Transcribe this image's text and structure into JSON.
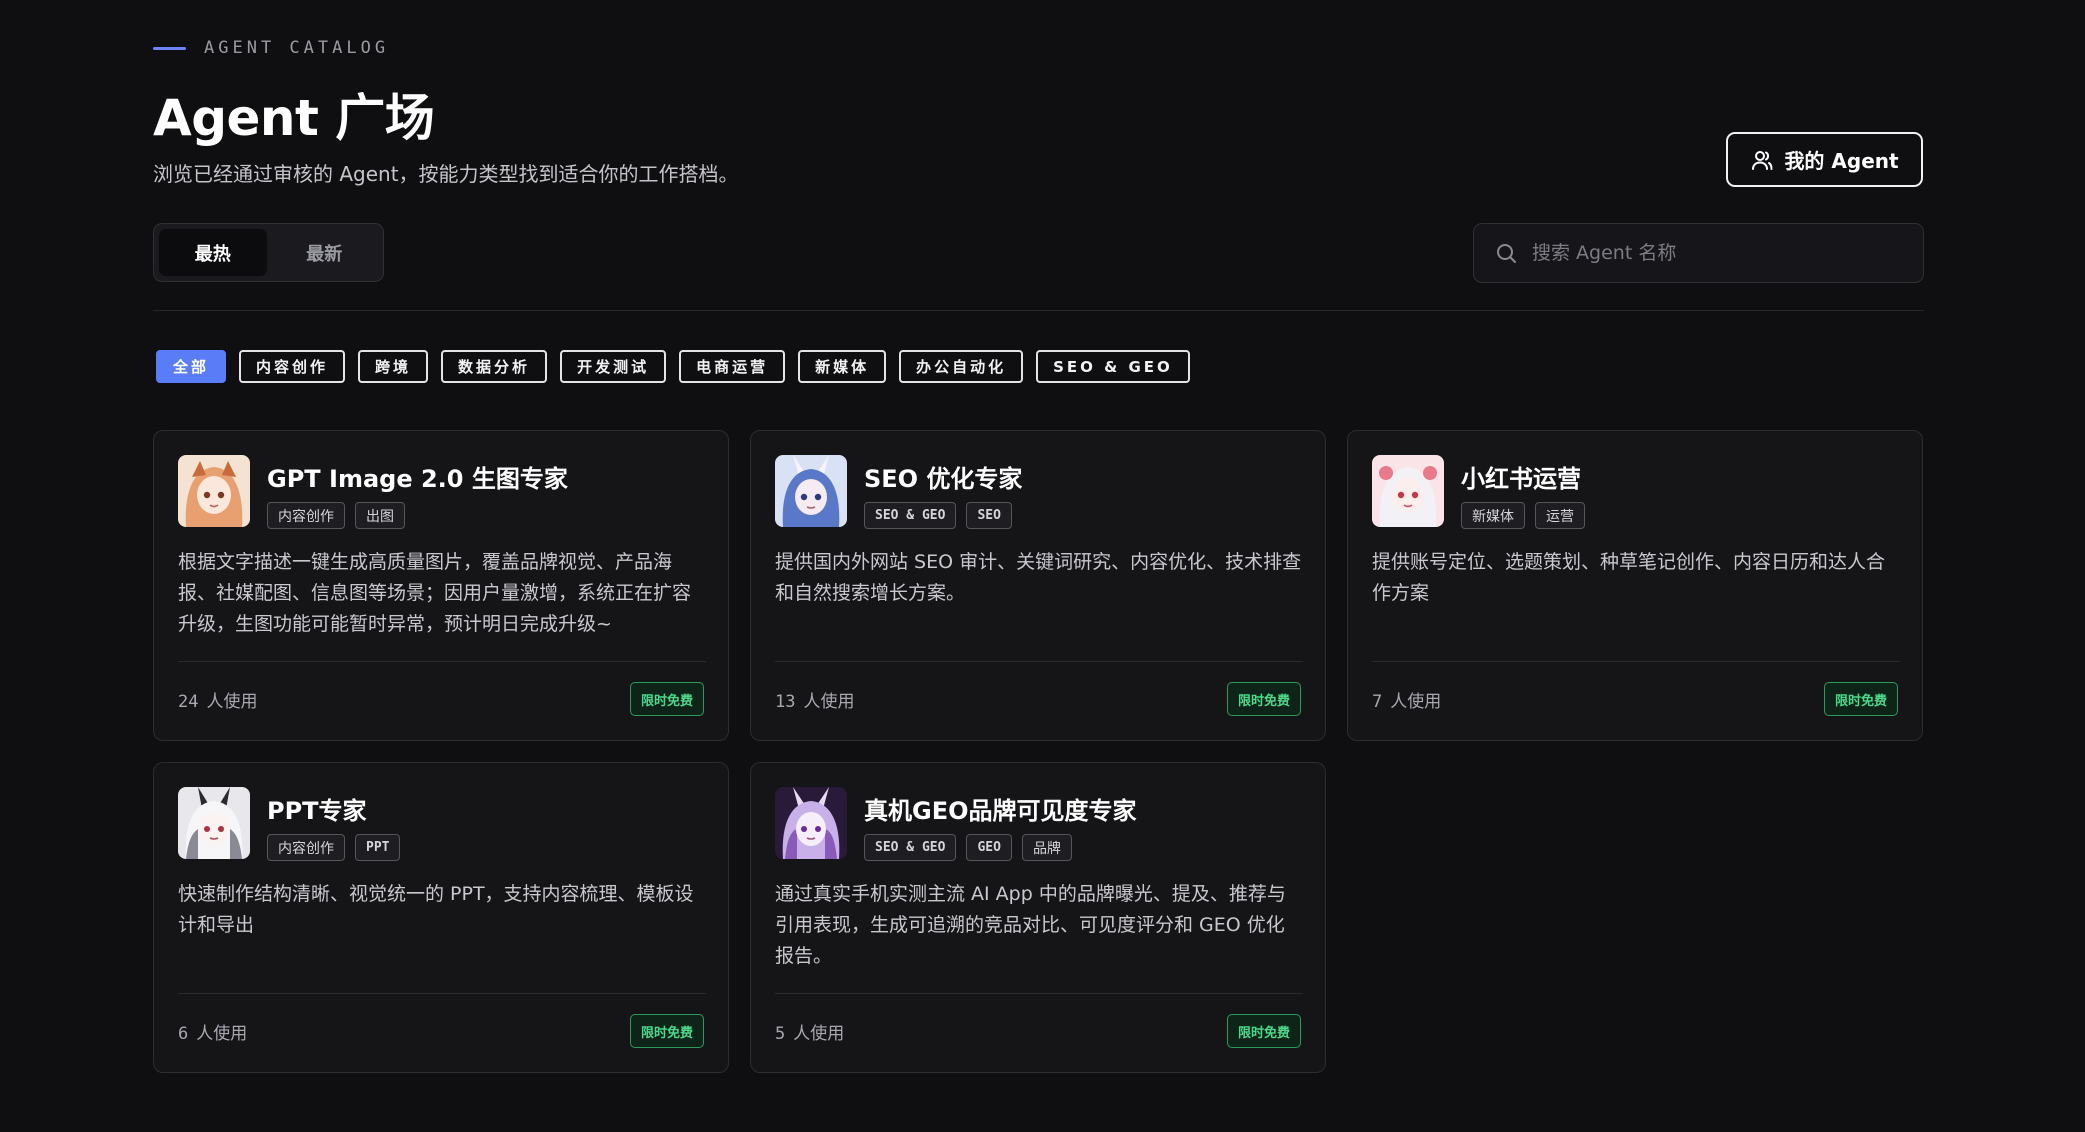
{
  "header": {
    "eyebrow": "AGENT CATALOG",
    "title": "Agent 广场",
    "subtitle": "浏览已经通过审核的 Agent，按能力类型找到适合你的工作搭档。",
    "my_agent_label": "我的 Agent"
  },
  "sort_tabs": [
    {
      "label": "最热",
      "active": true
    },
    {
      "label": "最新",
      "active": false
    }
  ],
  "search": {
    "placeholder": "搜索 Agent 名称",
    "value": ""
  },
  "categories": [
    {
      "label": "全部",
      "active": true
    },
    {
      "label": "内容创作",
      "active": false
    },
    {
      "label": "跨境",
      "active": false
    },
    {
      "label": "数据分析",
      "active": false
    },
    {
      "label": "开发测试",
      "active": false
    },
    {
      "label": "电商运营",
      "active": false
    },
    {
      "label": "新媒体",
      "active": false
    },
    {
      "label": "办公自动化",
      "active": false
    },
    {
      "label": "SEO & GEO",
      "active": false
    }
  ],
  "cards": [
    {
      "title": "GPT Image 2.0 生图专家",
      "tags": [
        "内容创作",
        "出图"
      ],
      "description": "根据文字描述一键生成高质量图片，覆盖品牌视觉、产品海报、社媒配图、信息图等场景；因用户量激增，系统正在扩容升级，生图功能可能暂时异常，预计明日完成升级~",
      "usage_count": "24",
      "usage_label": "人使用",
      "badge": "限时免费",
      "avatar_color": "#e8a070"
    },
    {
      "title": "SEO 优化专家",
      "tags": [
        "SEO & GEO",
        "SEO"
      ],
      "description": "提供国内外网站 SEO 审计、关键词研究、内容优化、技术排查和自然搜索增长方案。",
      "usage_count": "13",
      "usage_label": "人使用",
      "badge": "限时免费",
      "avatar_color": "#5a78c8"
    },
    {
      "title": "小红书运营",
      "tags": [
        "新媒体",
        "运营"
      ],
      "description": "提供账号定位、选题策划、种草笔记创作、内容日历和达人合作方案",
      "usage_count": "7",
      "usage_label": "人使用",
      "badge": "限时免费",
      "avatar_color": "#e87a8a"
    },
    {
      "title": "PPT专家",
      "tags": [
        "内容创作",
        "PPT"
      ],
      "description": "快速制作结构清晰、视觉统一的 PPT，支持内容梳理、模板设计和导出",
      "usage_count": "6",
      "usage_label": "人使用",
      "badge": "限时免费",
      "avatar_color": "#8a8a94"
    },
    {
      "title": "真机GEO品牌可见度专家",
      "tags": [
        "SEO & GEO",
        "GEO",
        "品牌"
      ],
      "description": "通过真实手机实测主流 AI App 中的品牌曝光、提及、推荐与引用表现，生成可追溯的竞品对比、可见度评分和 GEO 优化报告。",
      "usage_count": "5",
      "usage_label": "人使用",
      "badge": "限时免费",
      "avatar_color": "#8a5ab8"
    }
  ]
}
